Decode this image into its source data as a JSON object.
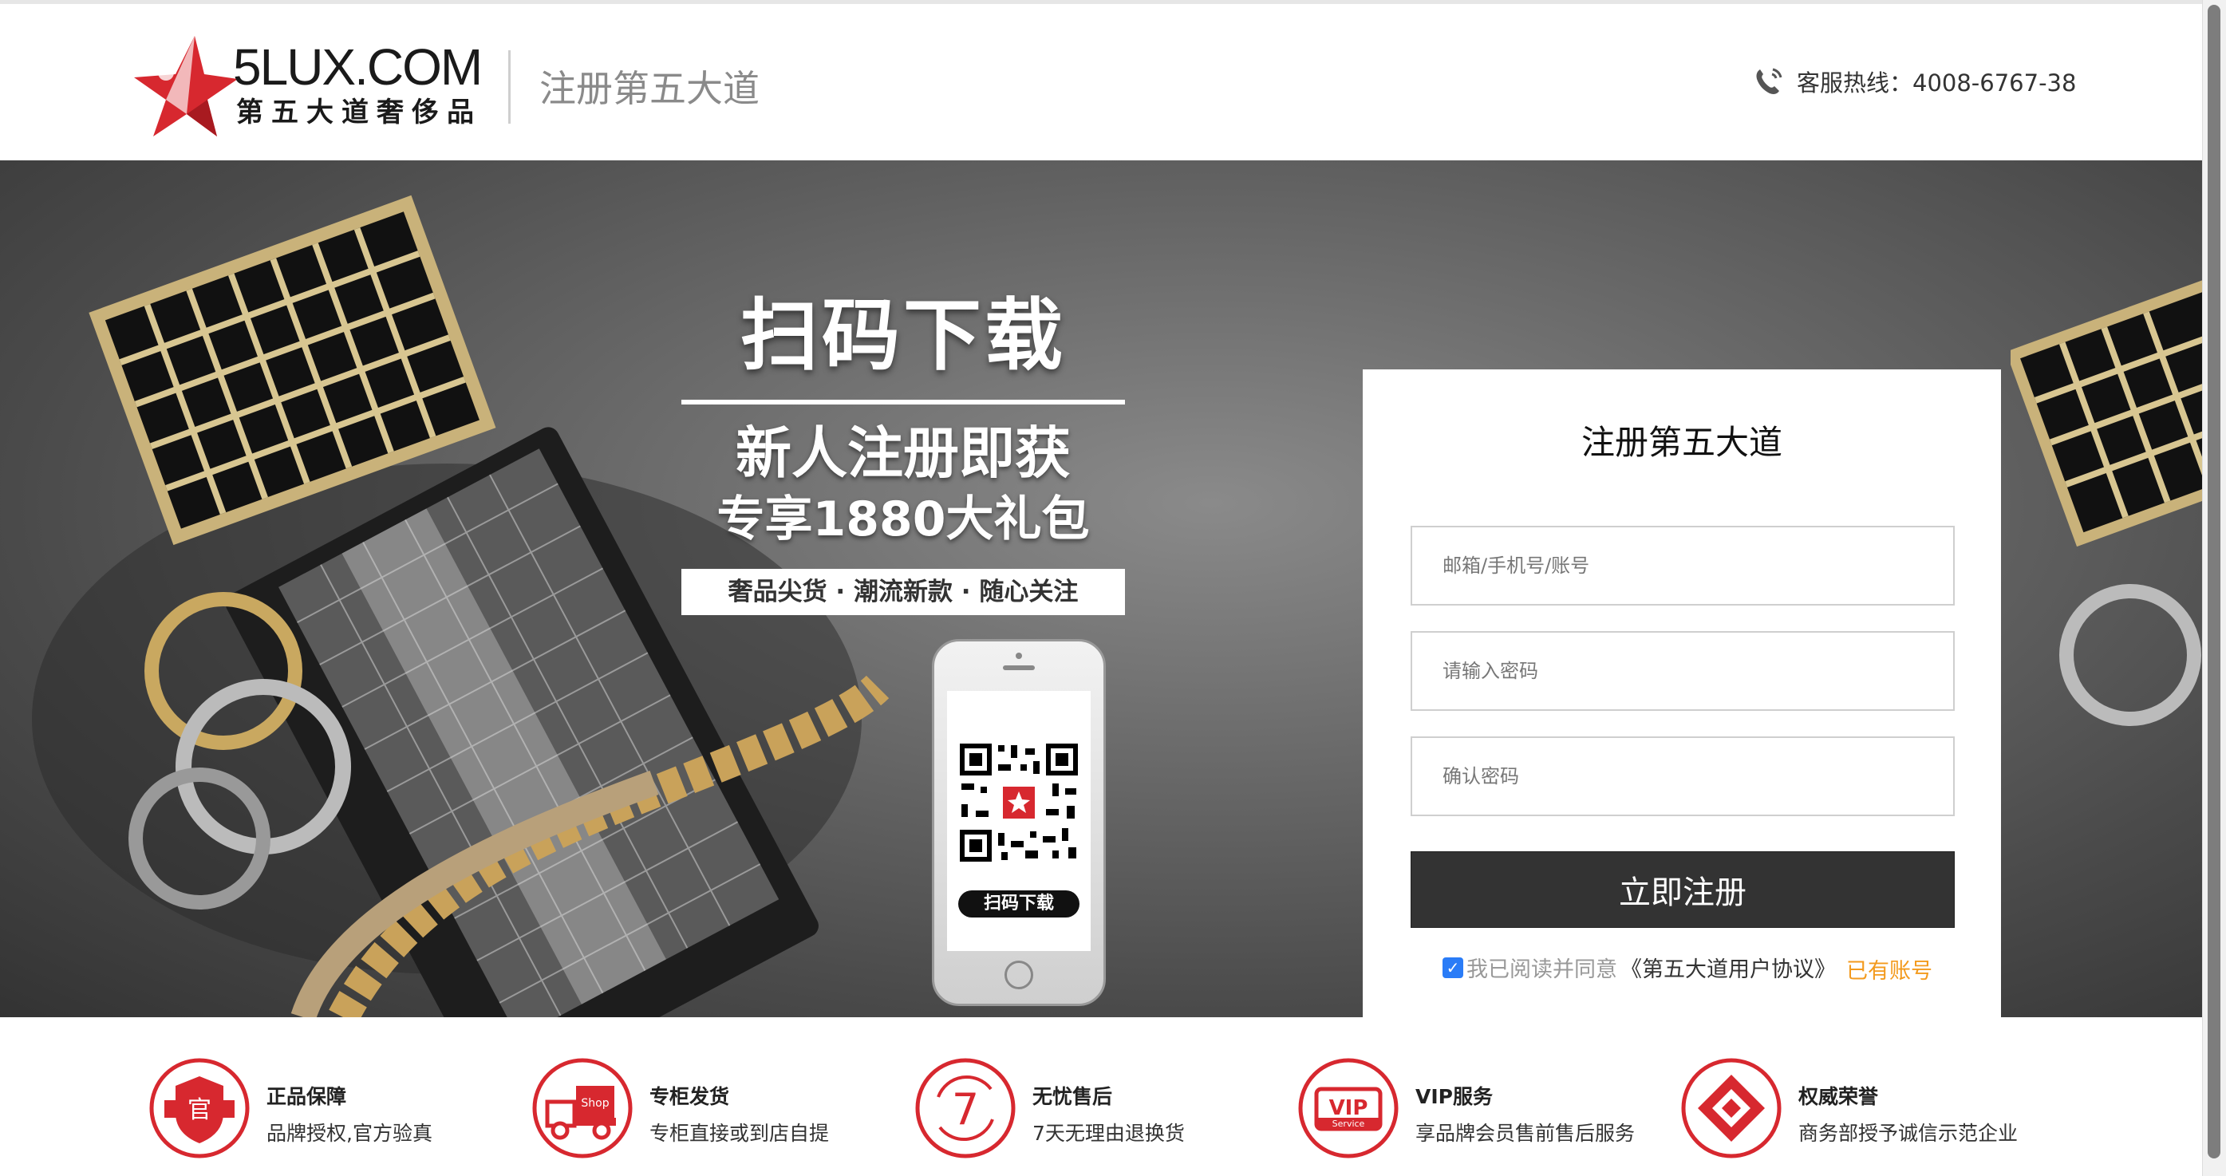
{
  "header": {
    "logo_main": "5LUX.COM",
    "logo_sub": "第五大道奢侈品",
    "title": "注册第五大道",
    "hotline": "客服热线：4008-6767-38",
    "hotline_icon": "phone-icon"
  },
  "banner": {
    "scan_title": "扫码下载",
    "promo_line1": "新人注册即获",
    "promo_line2": "专享1880大礼包",
    "promo_tags": "奢品尖货 · 潮流新款 · 随心关注",
    "qr_button": "扫码下载"
  },
  "register": {
    "title": "注册第五大道",
    "account_placeholder": "邮箱/手机号/账号",
    "password_placeholder": "请输入密码",
    "confirm_placeholder": "确认密码",
    "submit_label": "立即注册",
    "agree_checked": true,
    "agree_text": "我已阅读并同意",
    "agreement_link": "《第五大道用户协议》",
    "login_link": "已有账号"
  },
  "features": [
    {
      "icon": "official-badge-icon",
      "title": "正品保障",
      "desc": "品牌授权,官方验真"
    },
    {
      "icon": "shop-truck-icon",
      "title": "专柜发货",
      "desc": "专柜直接或到店自提"
    },
    {
      "icon": "seven-days-icon",
      "title": "无忧售后",
      "desc": "7天无理由退换货"
    },
    {
      "icon": "vip-service-icon",
      "title": "VIP服务",
      "desc": "享品牌会员售前售后服务"
    },
    {
      "icon": "honor-icon",
      "title": "权威荣誉",
      "desc": "商务部授予诚信示范企业"
    }
  ],
  "colors": {
    "accent_red": "#d7282f",
    "link_orange": "#f39a1d",
    "button_dark": "#333333",
    "checkbox_blue": "#2a7cf7"
  }
}
